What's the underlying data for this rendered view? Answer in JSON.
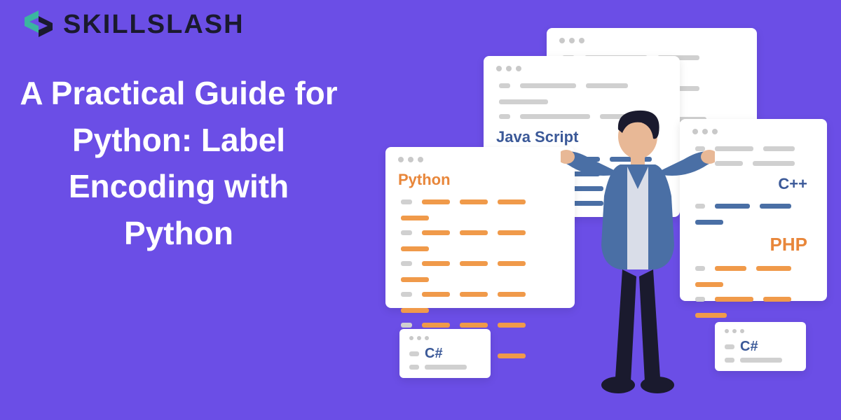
{
  "logo": {
    "text": "SKILLSLASH"
  },
  "title": "A Practical Guide for Python: Label Encoding with Python",
  "cards": {
    "javascript": "Java Script",
    "python": "Python",
    "cpp": "C++",
    "php": "PHP",
    "csharp_left": "C#",
    "csharp_right": "C#"
  },
  "colors": {
    "bg": "#6b4ee6",
    "orange": "#e8863a",
    "blue": "#3b5998"
  }
}
